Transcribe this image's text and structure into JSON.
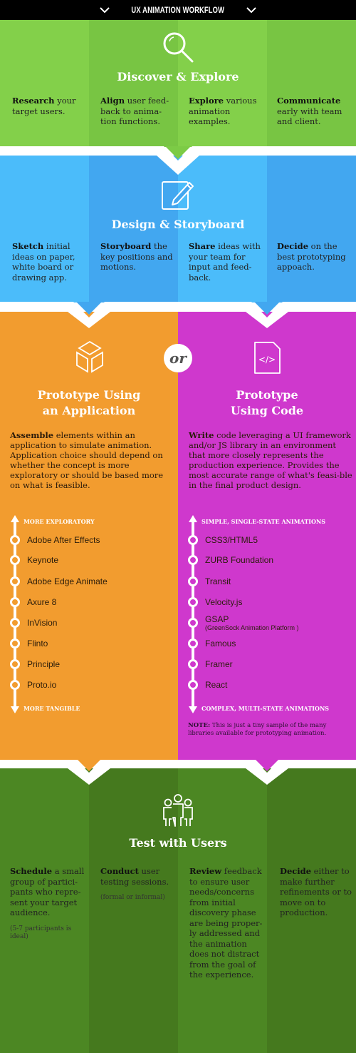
{
  "header": {
    "title": "UX ANIMATION WORKFLOW",
    "left_icon": "chevron-down-icon",
    "right_icon": "chevron-down-icon"
  },
  "colors": {
    "discover_green": "#83d04a",
    "design_blue": "#4bbcfa",
    "app_orange": "#f29c2f",
    "code_purple": "#cf38cd",
    "test_green": "#4c8723"
  },
  "discover": {
    "icon": "magnifier-icon",
    "title": "Discover & Explore",
    "columns": [
      {
        "bold": "Research",
        "text": " your target users."
      },
      {
        "bold": "Align",
        "text": " user feed-back to anima-tion functions."
      },
      {
        "bold": "Explore",
        "text": " various animation examples."
      },
      {
        "bold": "Communicate",
        "text": " early with team and client."
      }
    ]
  },
  "design": {
    "icon": "pencil-edit-icon",
    "title": "Design & Storyboard",
    "columns": [
      {
        "bold": "Sketch",
        "text": " initial ideas on paper, white board or drawing app."
      },
      {
        "bold": "Storyboard",
        "text": " the key positions and motions."
      },
      {
        "bold": "Share",
        "text": " ideas with your team for input and feed-back."
      },
      {
        "bold": "Decide",
        "text": " on the best prototyping appoach."
      }
    ]
  },
  "or_label": "or",
  "prototype_app": {
    "icon": "cube-icon",
    "title_line1": "Prototype Using",
    "title_line2": "an Application",
    "desc_bold": "Assemble",
    "desc": " elements within an application to simulate animation. Application choice should depend on whether the concept is more exploratory or should be based more on what is feasible.",
    "top_label": "MORE EXPLORATORY",
    "bottom_label": "MORE TANGIBLE",
    "items": [
      {
        "name": "Adobe After Effects"
      },
      {
        "name": "Keynote"
      },
      {
        "name": "Adobe Edge Animate"
      },
      {
        "name": "Axure 8"
      },
      {
        "name": "InVision"
      },
      {
        "name": "Flinto"
      },
      {
        "name": "Principle"
      },
      {
        "name": "Proto.io"
      }
    ]
  },
  "prototype_code": {
    "icon": "code-file-icon",
    "title_line1": "Prototype",
    "title_line2": "Using Code",
    "desc_bold": "Write",
    "desc": " code leveraging a UI framework and/or JS library in an environment that more closely represents the production experience. Provides the most accurate range of what's feasi-ble in the final product design.",
    "top_label": "SIMPLE, SINGLE-STATE ANIMATIONS",
    "bottom_label": "COMPLEX, MULTI-STATE ANIMATIONS",
    "items": [
      {
        "name": "CSS3/HTML5"
      },
      {
        "name": "ZURB Foundation"
      },
      {
        "name": "Transit"
      },
      {
        "name": "Velocity.js"
      },
      {
        "name": "GSAP",
        "sub": "(GreenSock Animation Platform )"
      },
      {
        "name": "Famous"
      },
      {
        "name": "Framer"
      },
      {
        "name": "React"
      }
    ],
    "note_bold": "NOTE:",
    "note": " This is just a tiny sample of the many libraries available for prototyping animation."
  },
  "test": {
    "icon": "users-group-icon",
    "title": "Test with Users",
    "columns": [
      {
        "bold": "Schedule",
        "text": " a small group of partici-pants who repre-sent your target audience.",
        "note": "(5-7 participants is ideal)"
      },
      {
        "bold": "Conduct",
        "text": " user testing sessions.",
        "note": "(formal or informal)"
      },
      {
        "bold": "Review",
        "text": " feedback to ensure user needs/concerns from initial discovery phase are being proper-ly addressed and the animation does not distract from the goal of the experience."
      },
      {
        "bold": "Decide",
        "text": " either to make further refinements or to move on to production."
      }
    ]
  }
}
